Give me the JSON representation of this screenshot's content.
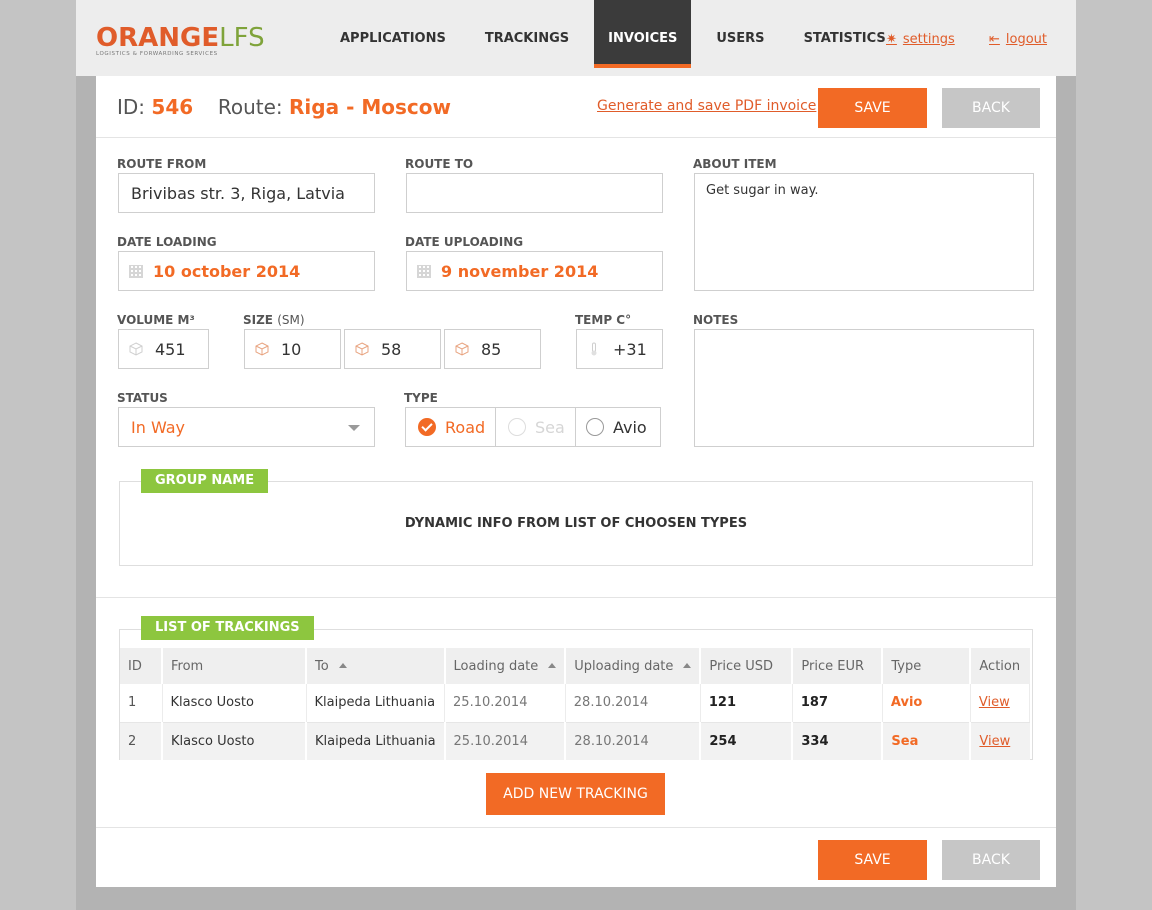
{
  "brand": {
    "name_main": "ORANGE",
    "name_suffix": "LFS",
    "tagline": "LOGISTICS & FORWARDING SERVICES",
    "accent": "#f26a25",
    "green": "#8dc63f"
  },
  "nav": {
    "items": [
      {
        "label": "APPLICATIONS"
      },
      {
        "label": "TRACKINGS"
      },
      {
        "label": "INVOICES"
      },
      {
        "label": "USERS"
      },
      {
        "label": "STATISTICS"
      }
    ],
    "active": "INVOICES",
    "settings_label": "settings",
    "logout_label": "logout"
  },
  "invoice": {
    "id_label": "ID:",
    "id_value": "546",
    "route_label": "Route:",
    "route_value": "Riga - Moscow",
    "pdf_link": "Generate and save PDF invoice",
    "save_label": "SAVE",
    "back_label": "BACK"
  },
  "form": {
    "route_from": {
      "label": "ROUTE FROM",
      "value": "Brivibas str. 3, Riga, Latvia"
    },
    "route_to": {
      "label": "ROUTE TO",
      "value": ""
    },
    "about_item": {
      "label": "ABOUT ITEM",
      "value": "Get sugar in way."
    },
    "date_loading": {
      "label": "DATE LOADING",
      "value": "10 october 2014"
    },
    "date_uploading": {
      "label": "DATE UPLOADING",
      "value": "9 november 2014"
    },
    "volume": {
      "label": "VOLUME M³",
      "value": "451"
    },
    "size": {
      "label": "SIZE",
      "unit": "(SM)",
      "values": [
        "10",
        "58",
        "85"
      ]
    },
    "temp": {
      "label": "TEMP C°",
      "value": "+31"
    },
    "notes": {
      "label": "NOTES",
      "value": ""
    },
    "status": {
      "label": "STATUS",
      "value": "In Way"
    },
    "type": {
      "label": "TYPE",
      "options": [
        "Road",
        "Sea",
        "Avio"
      ],
      "selected": "Road",
      "disabled": "Sea"
    }
  },
  "group": {
    "tag": "GROUP NAME",
    "content": "DYNAMIC INFO FROM LIST OF CHOOSEN TYPES"
  },
  "trackings": {
    "tag": "LIST OF TRACKINGS",
    "columns": [
      "ID",
      "From",
      "To",
      "Loading date",
      "Uploading date",
      "Price USD",
      "Price EUR",
      "Type",
      "Action"
    ],
    "rows": [
      {
        "id": "1",
        "from": "Klasco Uosto",
        "to": "Klaipeda Lithuania",
        "loading": "25.10.2014",
        "uploading": "28.10.2014",
        "usd": "121",
        "eur": "187",
        "type": "Avio",
        "action": "View"
      },
      {
        "id": "2",
        "from": "Klasco Uosto",
        "to": "Klaipeda Lithuania",
        "loading": "25.10.2014",
        "uploading": "28.10.2014",
        "usd": "254",
        "eur": "334",
        "type": "Sea",
        "action": "View"
      }
    ],
    "add_label": "ADD NEW TRACKING"
  }
}
